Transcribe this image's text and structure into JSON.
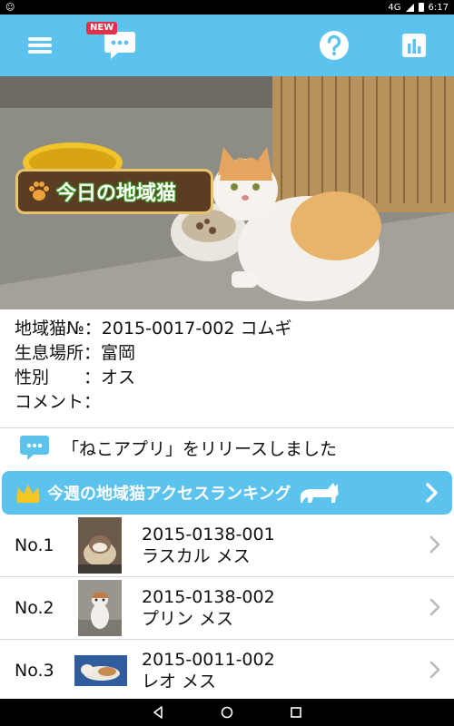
{
  "status_bar": {
    "time": "6:17",
    "signal": "4G"
  },
  "app_bar": {
    "new_badge": "NEW"
  },
  "photo": {
    "label": "今日の地域猫"
  },
  "cat_info": [
    {
      "key": "地域猫№",
      "value": "：2015-0017-002 コムギ"
    },
    {
      "key": "生息場所",
      "value": "：富岡"
    },
    {
      "key": "性別　　",
      "value": "：オス"
    },
    {
      "key": "コメント",
      "value": "："
    }
  ],
  "news": {
    "text": "「ねこアプリ」をリリースしました"
  },
  "ranking": {
    "title": "今週の地域猫アクセスランキング",
    "items": [
      {
        "rank": "No.1",
        "id": "2015-0138-001",
        "name": "ラスカル メス"
      },
      {
        "rank": "No.2",
        "id": "2015-0138-002",
        "name": "プリン メス"
      },
      {
        "rank": "No.3",
        "id": "2015-0011-002",
        "name": "レオ メス"
      }
    ]
  },
  "colors": {
    "accent": "#5cc3ee",
    "badge": "#e0314b",
    "label_bg": "#5a3d23"
  }
}
